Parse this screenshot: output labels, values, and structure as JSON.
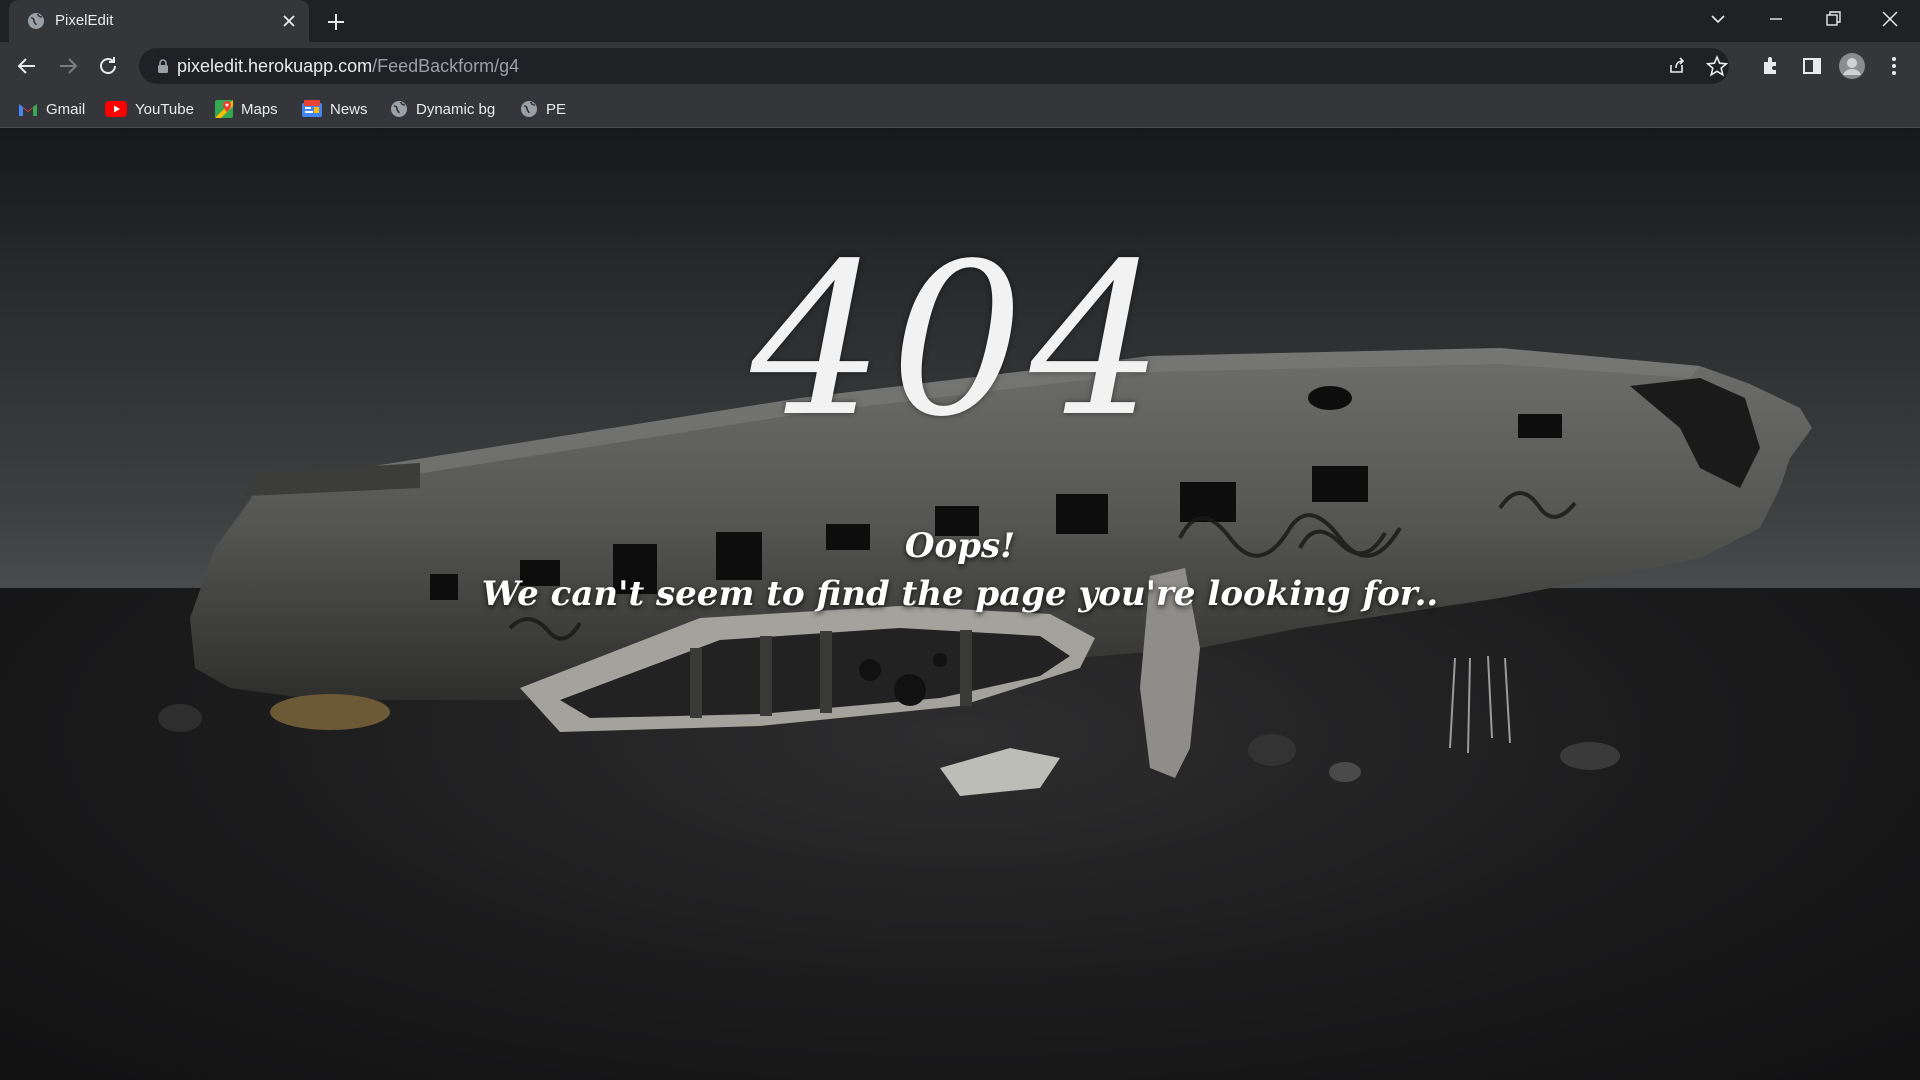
{
  "browser": {
    "tab": {
      "title": "PixelEdit"
    },
    "address_bar": {
      "host": "pixeledit.herokuapp.com",
      "path": "/FeedBackform/g4"
    },
    "bookmarks": [
      {
        "label": "Gmail",
        "icon": "gmail-icon"
      },
      {
        "label": "YouTube",
        "icon": "youtube-icon"
      },
      {
        "label": "Maps",
        "icon": "maps-icon"
      },
      {
        "label": "News",
        "icon": "news-icon"
      },
      {
        "label": "Dynamic bg",
        "icon": "globe-icon"
      },
      {
        "label": "PE",
        "icon": "globe-icon"
      }
    ],
    "colors": {
      "tab_bg": "#35363a",
      "frame_bg": "#202124",
      "omnibox_bg": "#202124"
    }
  },
  "page": {
    "code": "404",
    "heading": "Oops!",
    "message": "We can't seem to find the page you're looking for..",
    "background": "crashed-plane-photo"
  }
}
